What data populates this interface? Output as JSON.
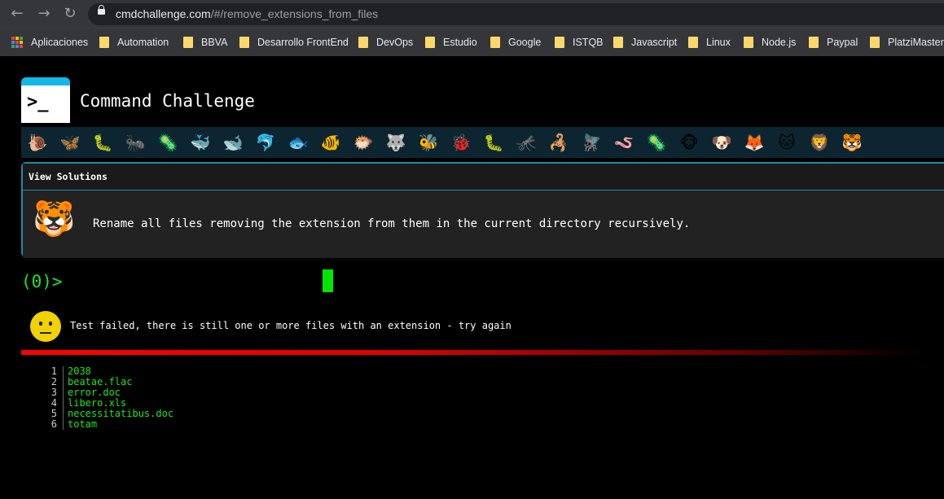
{
  "browser": {
    "back_label": "←",
    "forward_label": "→",
    "reload_label": "↻",
    "url_host": "cmdchallenge.com",
    "url_path": "/#/remove_extensions_from_files",
    "bookmarks": [
      "Aplicaciones",
      "Automation",
      "BBVA",
      "Desarrollo FrontEnd",
      "DevOps",
      "Estudio",
      "Google",
      "ISTQB",
      "Javascript",
      "Linux",
      "Node.js",
      "Paypal",
      "PlatziMaster"
    ]
  },
  "header": {
    "logo_glyph": ">_",
    "title": "Command Challenge"
  },
  "levels": {
    "icons": [
      "snail-icon",
      "butterfly-icon",
      "caterpillar-icon",
      "ant-icon",
      "microbe-icon",
      "whale-icon",
      "whale2-icon",
      "dolphin-icon",
      "fish-icon",
      "tropical-fish-icon",
      "pufferfish-icon",
      "wolf-icon",
      "bee-icon",
      "ladybug-icon",
      "worm-icon",
      "mosquito-icon",
      "scorpion-icon",
      "fly-icon",
      "snake-icon",
      "bacteria-icon",
      "monkey-icon",
      "dog-icon",
      "fox-icon",
      "cat-icon",
      "lion-icon",
      "tiger-icon"
    ],
    "glyphs": [
      "🐌",
      "🦋",
      "🐛",
      "🐜",
      "🦠",
      "🐳",
      "🐋",
      "🐬",
      "🐟",
      "🐠",
      "🐡",
      "🐺",
      "🐝",
      "🐞",
      "🐛",
      "🦟",
      "🦂",
      "🪰",
      "🪱",
      "🦠",
      "🐵",
      "🐶",
      "🦊",
      "🐱",
      "🦁",
      "🐯"
    ]
  },
  "challenge": {
    "view_solutions": "View Solutions",
    "avatar_glyph": "🐯",
    "description": "Rename all files removing the extension from them in the current directory recursively."
  },
  "terminal": {
    "prompt": "(0)>",
    "input_value": ""
  },
  "result": {
    "message": "Test failed, there is still one or more files with an extension - try again",
    "status_color": "#ff0000"
  },
  "output": {
    "lines": [
      {
        "n": "1",
        "text": "2038"
      },
      {
        "n": "2",
        "text": "beatae.flac"
      },
      {
        "n": "3",
        "text": "error.doc"
      },
      {
        "n": "4",
        "text": "libero.xls"
      },
      {
        "n": "5",
        "text": "necessitatibus.doc"
      },
      {
        "n": "6",
        "text": "totam"
      }
    ]
  }
}
